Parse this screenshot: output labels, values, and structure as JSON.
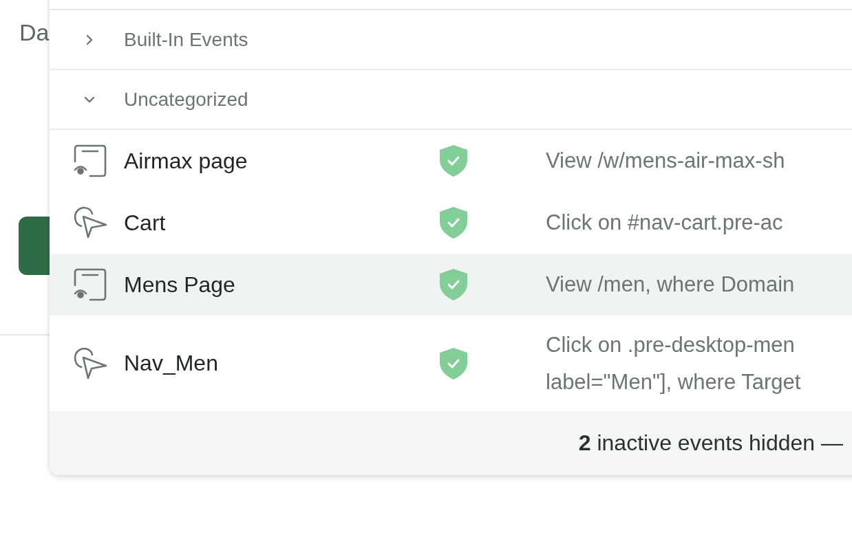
{
  "background": {
    "heading": "Da"
  },
  "categories": [
    {
      "label": "Built-In Events",
      "expanded": false
    },
    {
      "label": "Uncategorized",
      "expanded": true,
      "events": [
        {
          "kind": "view",
          "name": "Airmax page",
          "verified": true,
          "selected": false,
          "description": [
            "View /w/mens-air-max-sh"
          ]
        },
        {
          "kind": "click",
          "name": "Cart",
          "verified": true,
          "selected": false,
          "description": [
            "Click on #nav-cart.pre-ac"
          ]
        },
        {
          "kind": "view",
          "name": "Mens Page",
          "verified": true,
          "selected": true,
          "description": [
            "View /men, where Domain"
          ]
        },
        {
          "kind": "click",
          "name": "Nav_Men",
          "verified": true,
          "selected": false,
          "description": [
            "Click on .pre-desktop-men",
            "label=\"Men\"], where Target"
          ]
        }
      ]
    }
  ],
  "footer": "**2** inactive events hidden —"
}
